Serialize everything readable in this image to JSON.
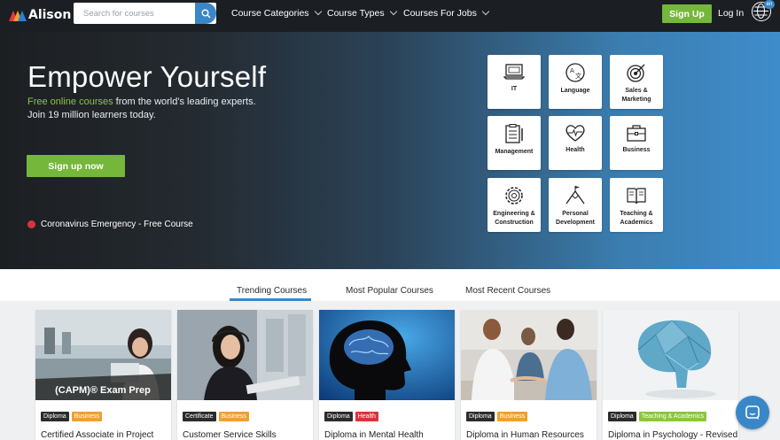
{
  "brand": {
    "name": "Alison",
    "logo_colors": [
      "#e63939",
      "#f0a030",
      "#2b7fd4"
    ]
  },
  "nav": {
    "search_placeholder": "Search for courses",
    "menus": [
      "Course Categories",
      "Course Types",
      "Courses For Jobs"
    ],
    "signup_label": "Sign Up",
    "login_label": "Log In",
    "lang_badge": "en"
  },
  "hero": {
    "title": "Empower Yourself",
    "sub_highlight": "Free online courses",
    "sub_rest": " from the world's leading experts.",
    "sub_line2": "Join 19 million learners today.",
    "signup_label": "Sign up now",
    "emergency_label": "Coronavirus Emergency - Free Course"
  },
  "categories": [
    {
      "label": "IT",
      "icon": "laptop-icon"
    },
    {
      "label": "Language",
      "icon": "language-icon"
    },
    {
      "label": "Sales & Marketing",
      "icon": "target-icon"
    },
    {
      "label": "Management",
      "icon": "clipboard-icon"
    },
    {
      "label": "Health",
      "icon": "heart-pulse-icon"
    },
    {
      "label": "Business",
      "icon": "briefcase-icon"
    },
    {
      "label": "Engineering & Construction",
      "icon": "gears-icon"
    },
    {
      "label": "Personal Development",
      "icon": "mountain-flag-icon"
    },
    {
      "label": "Teaching & Academics",
      "icon": "book-icon"
    }
  ],
  "tabs": [
    "Trending Courses",
    "Most Popular Courses",
    "Most Recent Courses"
  ],
  "courses": [
    {
      "title": "Certified Associate in Project",
      "overlay": "(CAPM)® Exam Prep",
      "tags": [
        {
          "label": "Diploma",
          "color": "#2b2b2b"
        },
        {
          "label": "Business",
          "color": "#f0a030"
        }
      ]
    },
    {
      "title": "Customer Service Skills",
      "tags": [
        {
          "label": "Certificate",
          "color": "#2b2b2b"
        },
        {
          "label": "Business",
          "color": "#f0a030"
        }
      ]
    },
    {
      "title": "Diploma in Mental Health",
      "tags": [
        {
          "label": "Diploma",
          "color": "#2b2b2b"
        },
        {
          "label": "Health",
          "color": "#d9343a"
        }
      ]
    },
    {
      "title": "Diploma in Human Resources",
      "tags": [
        {
          "label": "Diploma",
          "color": "#2b2b2b"
        },
        {
          "label": "Business",
          "color": "#f0a030"
        }
      ]
    },
    {
      "title": "Diploma in Psychology - Revised",
      "tags": [
        {
          "label": "Diploma",
          "color": "#2b2b2b"
        },
        {
          "label": "Teaching & Academics",
          "color": "#8cc63f"
        }
      ]
    }
  ]
}
